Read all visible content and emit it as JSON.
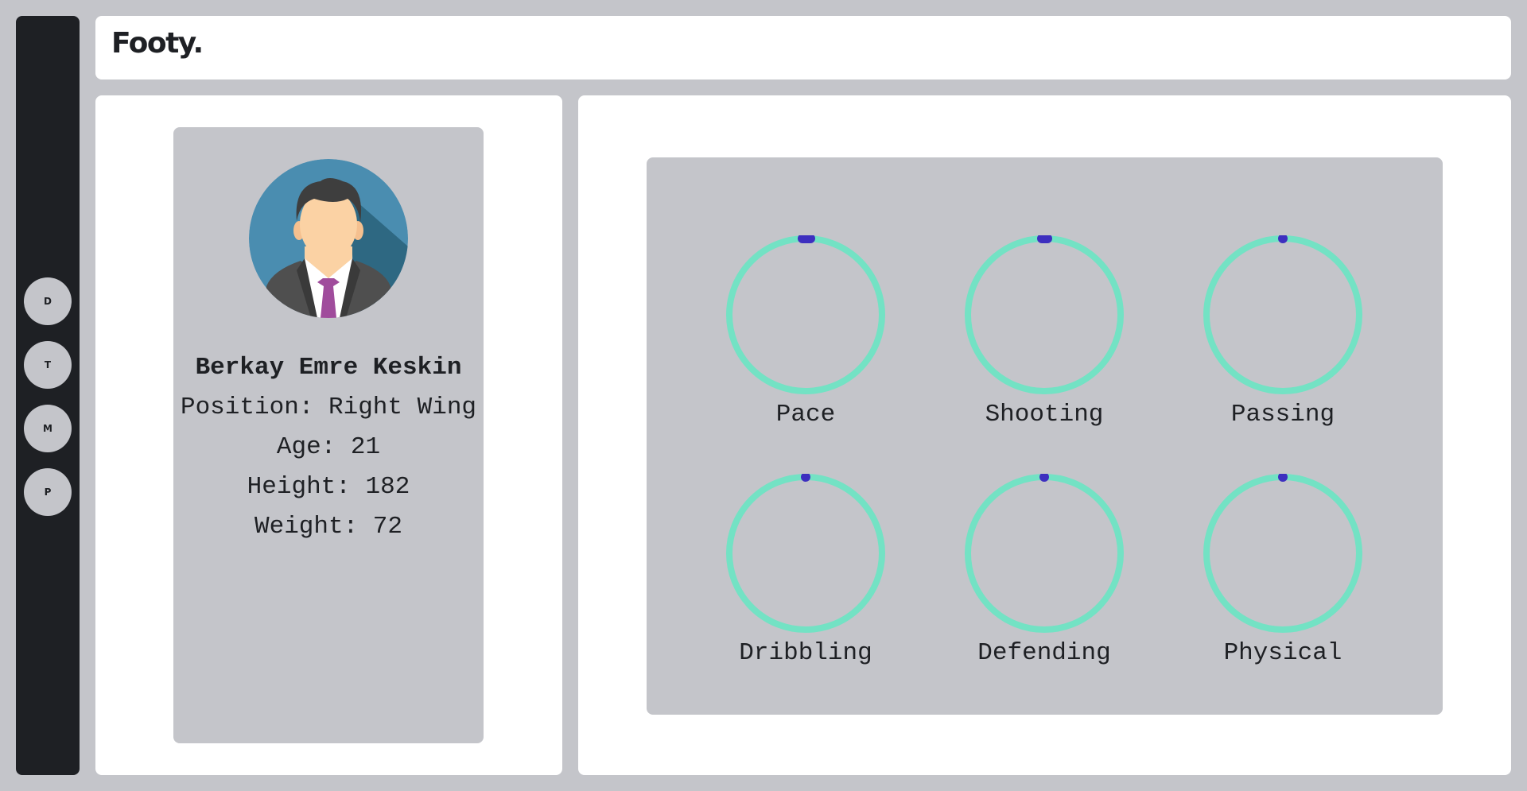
{
  "app": {
    "logo": "Footy."
  },
  "nav": {
    "items": [
      {
        "label": "D"
      },
      {
        "label": "T"
      },
      {
        "label": "M"
      },
      {
        "label": "P"
      }
    ]
  },
  "player": {
    "name": "Berkay Emre Keskin",
    "position": "Position: Right Wing",
    "age": "Age: 21",
    "height": "Height: 182",
    "weight": "Weight: 72"
  },
  "stats": [
    {
      "label": "Pace"
    },
    {
      "label": "Shooting"
    },
    {
      "label": "Passing"
    },
    {
      "label": "Dribbling"
    },
    {
      "label": "Defending"
    },
    {
      "label": "Physical"
    }
  ],
  "colors": {
    "ring": "#73e2c4",
    "progress": "#3d2fbf",
    "sidebar": "#1e2024",
    "background": "#c4c5ca"
  }
}
